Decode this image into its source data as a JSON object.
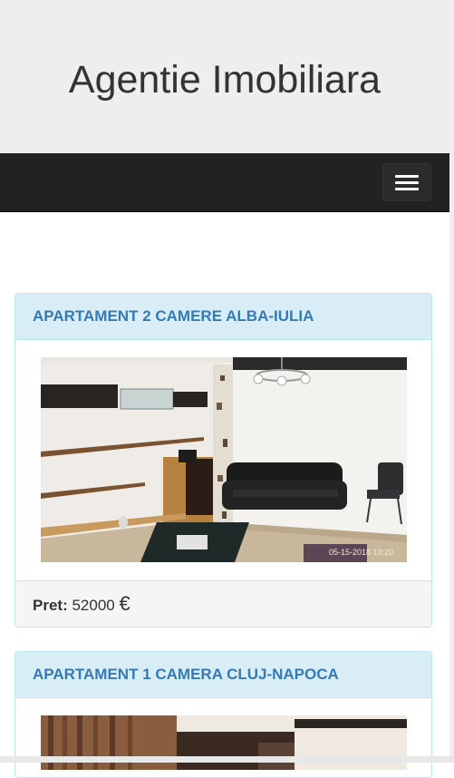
{
  "header": {
    "title": "Agentie Imobiliara"
  },
  "navbar": {
    "toggle_icon": "hamburger-menu-icon"
  },
  "listings": [
    {
      "title": "APARTAMENT 2 CAMERE ALBA-IULIA",
      "price_label": "Pret:",
      "price_value": "52000",
      "currency": "€",
      "photo_timestamp": "05-15-2018 13:20"
    },
    {
      "title": "APARTAMENT 1 CAMERA CLUJ-NAPOCA"
    }
  ]
}
